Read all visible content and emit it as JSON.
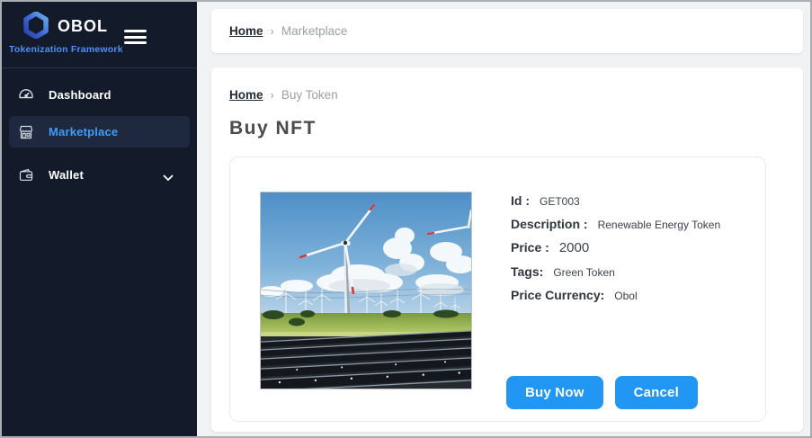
{
  "sidebar": {
    "brand": {
      "name": "OBOL",
      "subtitle": "Tokenization Framework"
    },
    "items": [
      {
        "label": "Dashboard",
        "icon": "dashboard-gauge-icon",
        "active": false
      },
      {
        "label": "Marketplace",
        "icon": "storefront-icon",
        "active": true
      },
      {
        "label": "Wallet",
        "icon": "wallet-icon",
        "active": false,
        "has_submenu": true
      }
    ],
    "colors": {
      "background": "#131b2b",
      "active_item_bg": "#1e2940",
      "active_text": "#3f9bf5",
      "subtitle_blue": "#4e8ef7"
    }
  },
  "topbar": {
    "breadcrumb": {
      "home": "Home",
      "separator": "›",
      "current": "Marketplace"
    }
  },
  "page": {
    "breadcrumb": {
      "home": "Home",
      "separator": "›",
      "current": "Buy Token"
    },
    "title": "Buy NFT",
    "nft": {
      "image_alt": "renewable-energy-wind-turbines-over-solar-panel-field",
      "fields": [
        {
          "label": "Id :",
          "value": "GET003"
        },
        {
          "label": "Description :",
          "value": "Renewable Energy Token"
        },
        {
          "label": "Price :",
          "value": "2000"
        },
        {
          "label": "Tags:",
          "value": "Green Token"
        },
        {
          "label": "Price Currency:",
          "value": "Obol"
        }
      ],
      "buttons": {
        "buy": "Buy Now",
        "cancel": "Cancel"
      },
      "button_color": "#2196f3"
    }
  }
}
